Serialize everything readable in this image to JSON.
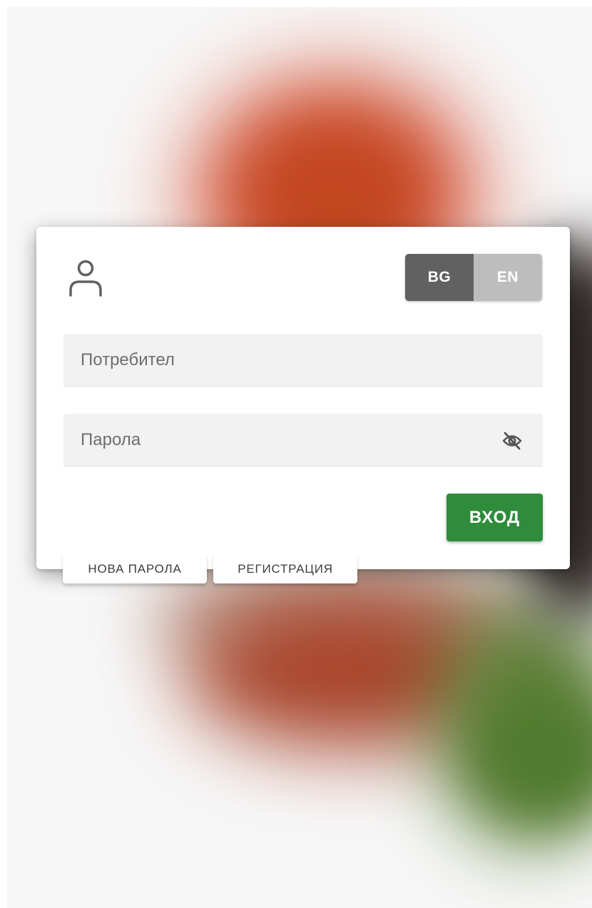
{
  "login": {
    "language_options": [
      "BG",
      "EN"
    ],
    "selected_language": "BG",
    "username": {
      "placeholder": "Потребител",
      "value": ""
    },
    "password": {
      "placeholder": "Парола",
      "value": ""
    },
    "submit_label": "ВХОД",
    "links": {
      "new_password": "НОВА ПАРОЛА",
      "register": "РЕГИСТРАЦИЯ"
    }
  },
  "icons": {
    "user": "user-icon",
    "visibility_toggle": "eye-off-icon"
  },
  "colors": {
    "lang_active": "#616161",
    "lang_inactive": "#bdbdbd",
    "submit_button": "#2f8c3a",
    "input_background": "#f2f2f2"
  }
}
